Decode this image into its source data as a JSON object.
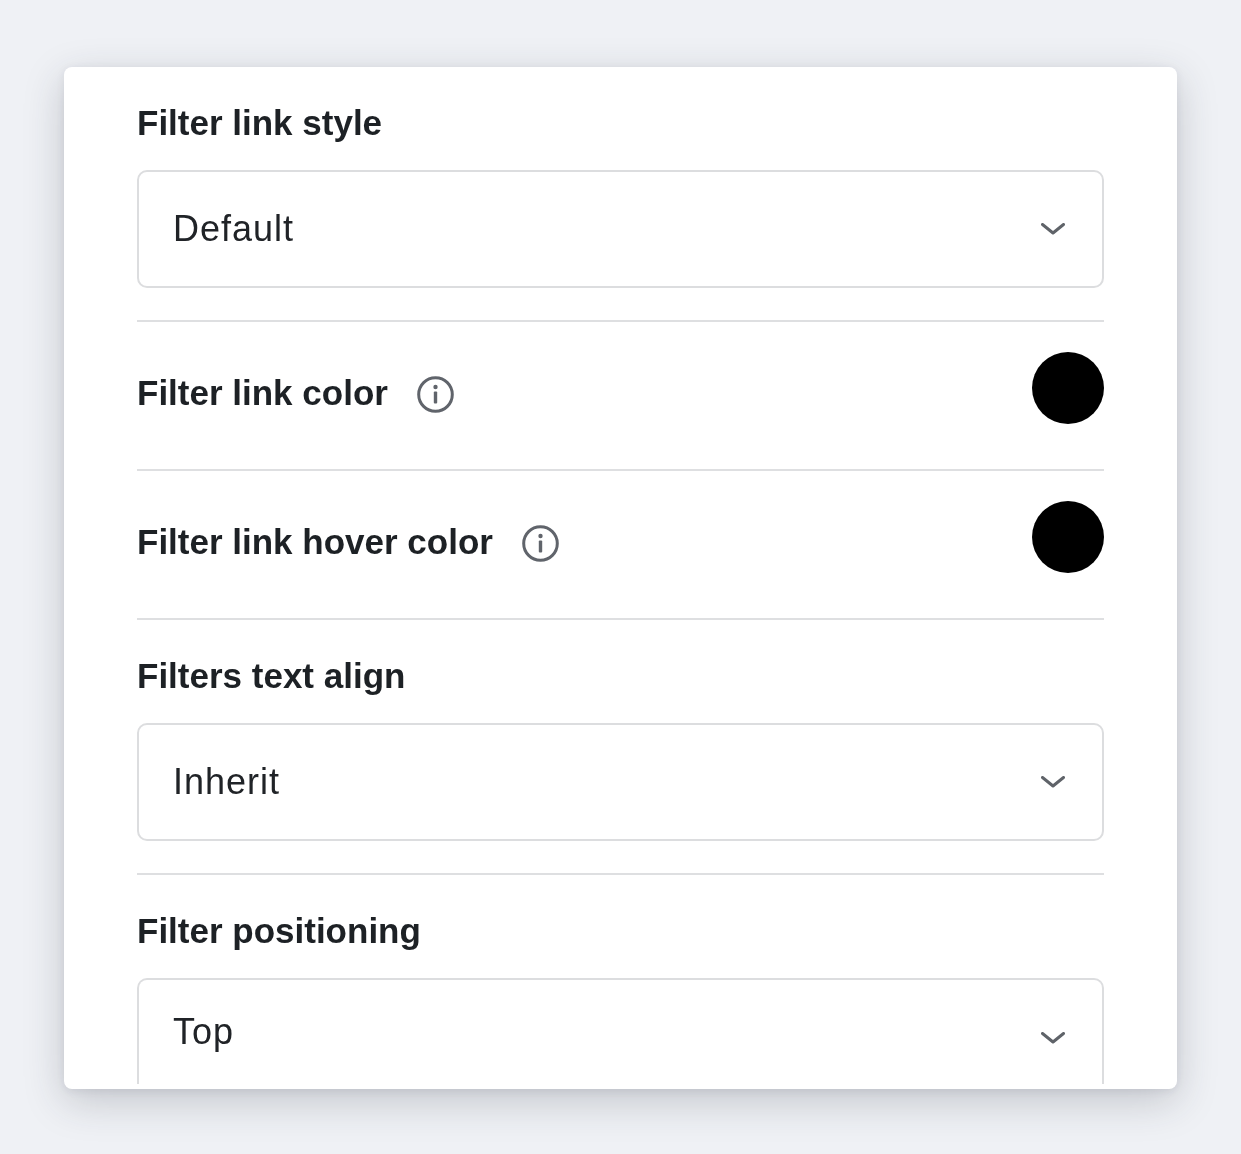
{
  "settings": [
    {
      "kind": "select",
      "label": "Filter link style",
      "value": "Default"
    },
    {
      "kind": "color",
      "label": "Filter link color",
      "info": true,
      "color": "#000000"
    },
    {
      "kind": "color",
      "label": "Filter link hover color",
      "info": true,
      "color": "#000000"
    },
    {
      "kind": "select",
      "label": "Filters text align",
      "value": "Inherit"
    },
    {
      "kind": "select",
      "label": "Filter positioning",
      "value": "Top"
    }
  ]
}
